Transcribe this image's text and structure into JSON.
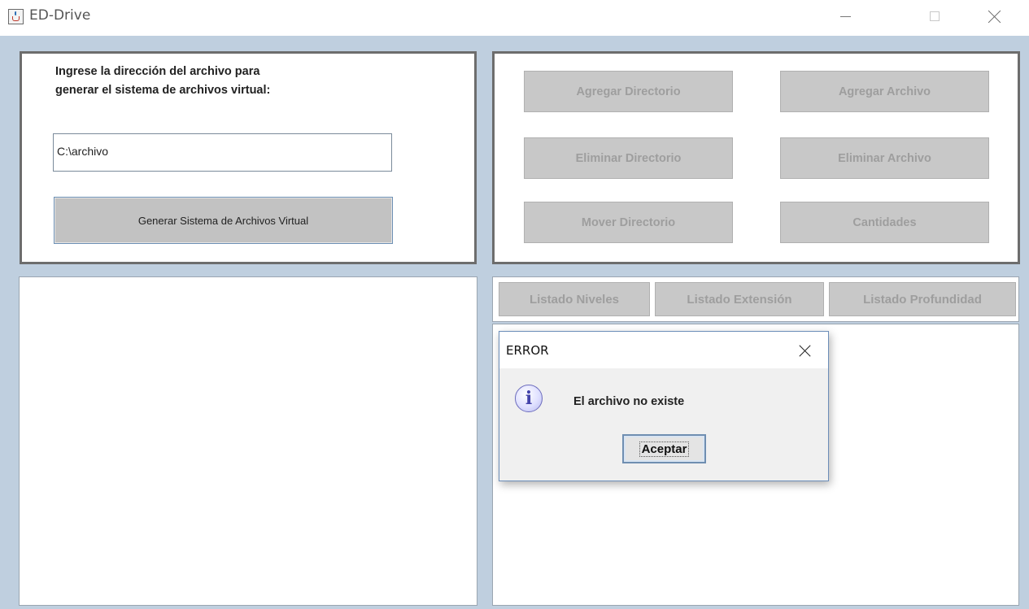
{
  "window": {
    "title": "ED-Drive",
    "icon": "java-cup-icon"
  },
  "input_panel": {
    "prompt_line1": "Ingrese la dirección del archivo para",
    "prompt_line2": "generar el sistema de archivos virtual:",
    "path_value": "C:\\archivo",
    "generate_label": "Generar Sistema de Archivos Virtual"
  },
  "actions": {
    "add_directory": "Agregar Directorio",
    "add_file": "Agregar Archivo",
    "delete_directory": "Eliminar Directorio",
    "delete_file": "Eliminar Archivo",
    "move_directory": "Mover Directorio",
    "counts": "Cantidades"
  },
  "listing_tabs": {
    "levels": "Listado Niveles",
    "extension": "Listado Extensión",
    "depth": "Listado Profundidad"
  },
  "dialog": {
    "title": "ERROR",
    "icon": "info-icon",
    "message": "El archivo no existe",
    "ok_label": "Aceptar"
  },
  "colors": {
    "background": "#bfcfdf",
    "disabled_button": "#c8c8c8",
    "disabled_text": "#9e9e9e",
    "panel_border": "#6d6d6d"
  }
}
